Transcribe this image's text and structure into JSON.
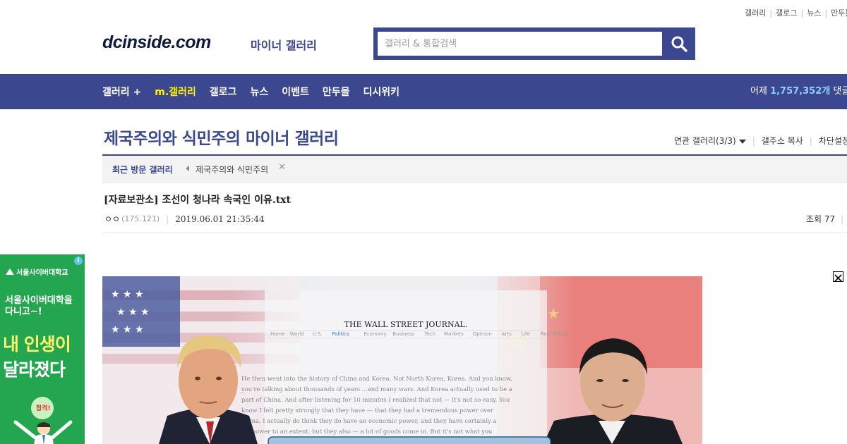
{
  "util_links": [
    "갤러리",
    "갤로그",
    "뉴스",
    "만두몰"
  ],
  "header": {
    "logo": "dcinside.com",
    "logo_sub": "마이너 갤러리",
    "search_placeholder": "갤러리 & 통합검색"
  },
  "nav": {
    "items": [
      "갤러리 +",
      "m.갤러리",
      "갤로그",
      "뉴스",
      "이벤트",
      "만두몰",
      "디시위키"
    ],
    "active": "m.갤러리",
    "stat_prefix": "어제",
    "stat_count": "1,757,352개",
    "stat_suffix": "댓글"
  },
  "gallery": {
    "title": "제국주의와 식민주의 마이너 갤러리",
    "related": "연관 갤러리(3/3)",
    "copy_addr": "갤주소 복사",
    "block_settings": "차단설정"
  },
  "recent": {
    "label": "최근 방문 갤러리",
    "items": [
      "제국주의와 식민주의"
    ]
  },
  "post": {
    "title": "[자료보관소] 조선이 청나라 속국인 이유.txt",
    "nick": "ㅇㅇ",
    "ip": "(175.121)",
    "date": "2019.06.01 21:35:44",
    "views": "조회 77"
  },
  "ad": {
    "brand": "서울사이버대학교",
    "line1": "서울사이버대학을",
    "line1b": "다니고~!",
    "line2": "내 인생이",
    "line3": "달라졌다",
    "badge": "합격!"
  },
  "article_image": {
    "masthead": "THE WALL STREET JOURNAL.",
    "menu": [
      "Home",
      "World",
      "U.S.",
      "Politics",
      "Economy",
      "Business",
      "Tech",
      "Markets",
      "Opinion",
      "Arts",
      "Life",
      "Real Estate"
    ],
    "body": [
      "He then went into the history of China and Korea. Not North Korea, Korea. And you know,",
      "you're talking about thousands of years ...and many wars. And Korea actually used to be a",
      "part of China. And after listening for 10 minutes I realized that not — it's not so easy. You",
      "know I felt pretty strongly that they have — that they had a tremendous power over",
      "China. I actually do think they do have an economic power, and they have certainly a",
      "...r power to an extent, but they also — a lot of goods come in. But it's not what you"
    ]
  },
  "colors": {
    "brand_blue": "#3b4890",
    "active_nav": "#fff000",
    "ad_green": "#24a651"
  }
}
